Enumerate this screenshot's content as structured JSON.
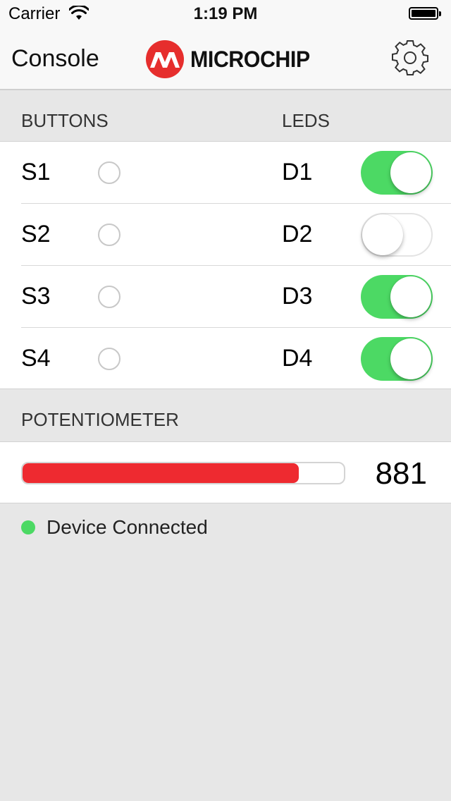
{
  "status_bar": {
    "carrier": "Carrier",
    "time": "1:19 PM"
  },
  "nav": {
    "title": "Console",
    "brand": "MICROCHIP",
    "settings_icon": "gear-icon",
    "brand_color": "#e62e2d"
  },
  "buttons_section": {
    "buttons_header": "BUTTONS",
    "leds_header": "LEDS"
  },
  "rows": [
    {
      "button": "S1",
      "led": "D1",
      "led_on": true
    },
    {
      "button": "S2",
      "led": "D2",
      "led_on": false
    },
    {
      "button": "S3",
      "led": "D3",
      "led_on": true
    },
    {
      "button": "S4",
      "led": "D4",
      "led_on": true
    }
  ],
  "potentiometer": {
    "header": "POTENTIOMETER",
    "value": "881",
    "fill_fraction": 0.86,
    "bar_color": "#ee2a30"
  },
  "connection": {
    "status": "Device Connected",
    "color": "#4cd964"
  },
  "colors": {
    "switch_on": "#4cd964",
    "background": "#e7e7e7"
  }
}
